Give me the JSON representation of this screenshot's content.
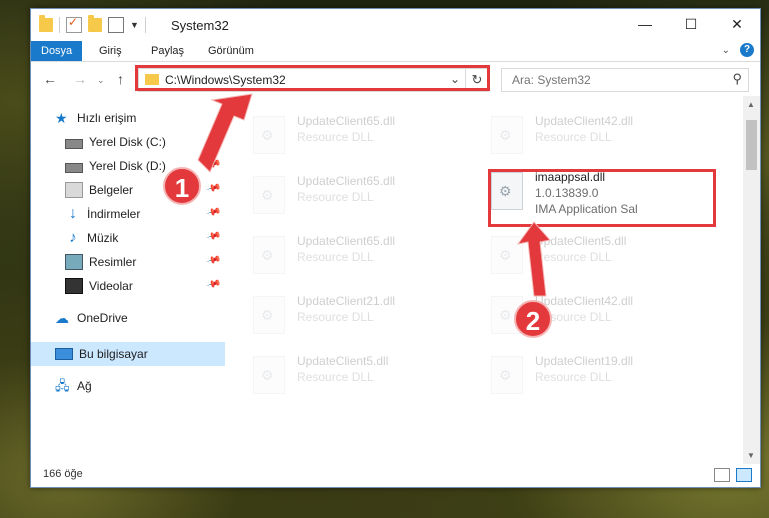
{
  "window": {
    "title": "System32",
    "controls": [
      "—",
      "☐",
      "✕"
    ]
  },
  "ribbon": {
    "tabs": [
      "Dosya",
      "Giriş",
      "Paylaş",
      "Görünüm"
    ],
    "active_tab": "Dosya",
    "help": "?"
  },
  "navigation": {
    "address": "C:\\Windows\\System32",
    "search_placeholder": "Ara: System32"
  },
  "sidebar": {
    "items": [
      {
        "label": "Hızlı erişim",
        "icon": "star-icon"
      },
      {
        "label": "Yerel Disk (C:)",
        "icon": "drive-icon",
        "pinned": true
      },
      {
        "label": "Yerel Disk (D:)",
        "icon": "drive-icon",
        "pinned": true
      },
      {
        "label": "Belgeler",
        "icon": "documents-icon",
        "pinned": true
      },
      {
        "label": "İndirmeler",
        "icon": "download-icon",
        "pinned": true
      },
      {
        "label": "Müzik",
        "icon": "music-icon",
        "pinned": true
      },
      {
        "label": "Resimler",
        "icon": "pictures-icon",
        "pinned": true
      },
      {
        "label": "Videolar",
        "icon": "videos-icon",
        "pinned": true
      },
      {
        "label": "OneDrive",
        "icon": "cloud-icon"
      },
      {
        "label": "Bu bilgisayar",
        "icon": "computer-icon",
        "selected": true
      },
      {
        "label": "Ağ",
        "icon": "network-icon"
      }
    ]
  },
  "files": [
    {
      "name": "UpdateClient65.dll",
      "desc": "Resource DLL",
      "faded": true
    },
    {
      "name": "UpdateClient42.dll",
      "desc": "Resource DLL",
      "faded": true
    },
    {
      "name": "UpdateClient65.dll",
      "desc": "Resource DLL",
      "faded": true
    },
    {
      "name": "imaappsal.dll",
      "version": "1.0.13839.0",
      "desc": "IMA Application Sal",
      "faded": false
    },
    {
      "name": "UpdateClient65.dll",
      "desc": "Resource DLL",
      "faded": true
    },
    {
      "name": "UpdateClient5.dll",
      "desc": "Resource DLL",
      "faded": true
    },
    {
      "name": "UpdateClient21.dll",
      "desc": "Resource DLL",
      "faded": true
    },
    {
      "name": "UpdateClient42.dll",
      "desc": "Resource DLL",
      "faded": true
    },
    {
      "name": "UpdateClient5.dll",
      "desc": "Resource DLL",
      "faded": true
    },
    {
      "name": "UpdateClient19.dll",
      "desc": "Resource DLL",
      "faded": true
    }
  ],
  "status": {
    "item_count": "166 öğe"
  },
  "callouts": [
    "1",
    "2"
  ],
  "colors": {
    "accent": "#1979ca",
    "highlight": "#e3393c",
    "selection": "#cce8ff"
  }
}
